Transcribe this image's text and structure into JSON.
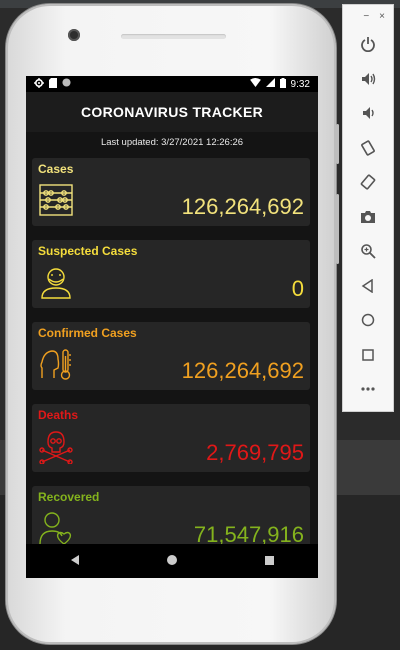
{
  "status_bar": {
    "time": "9:32"
  },
  "app": {
    "title": "CORONAVIRUS TRACKER",
    "last_updated": "Last updated: 3/27/2021 12:26:26"
  },
  "cards": [
    {
      "id": "cases",
      "title": "Cases",
      "value": "126,264,692",
      "color": "#f2e27c",
      "icon": "abacus-icon"
    },
    {
      "id": "suspected",
      "title": "Suspected Cases",
      "value": "0",
      "color": "#f5dd3c",
      "icon": "masked-person-icon"
    },
    {
      "id": "confirmed",
      "title": "Confirmed Cases",
      "value": "126,264,692",
      "color": "#f0a020",
      "icon": "fever-thermometer-icon"
    },
    {
      "id": "deaths",
      "title": "Deaths",
      "value": "2,769,795",
      "color": "#e01818",
      "icon": "skull-crossbones-icon"
    },
    {
      "id": "recovered",
      "title": "Recovered",
      "value": "71,547,916",
      "color": "#84b31d",
      "icon": "recovered-person-icon"
    }
  ],
  "nav": [
    "back-icon",
    "home-icon",
    "recents-icon"
  ],
  "emulator_toolbar": {
    "window_controls": [
      "−",
      "×"
    ],
    "buttons": [
      "power-icon",
      "volume-up-icon",
      "volume-down-icon",
      "rotate-left-icon",
      "rotate-right-icon",
      "screenshot-icon",
      "zoom-icon",
      "back-icon",
      "home-icon",
      "overview-icon",
      "more-icon"
    ]
  }
}
